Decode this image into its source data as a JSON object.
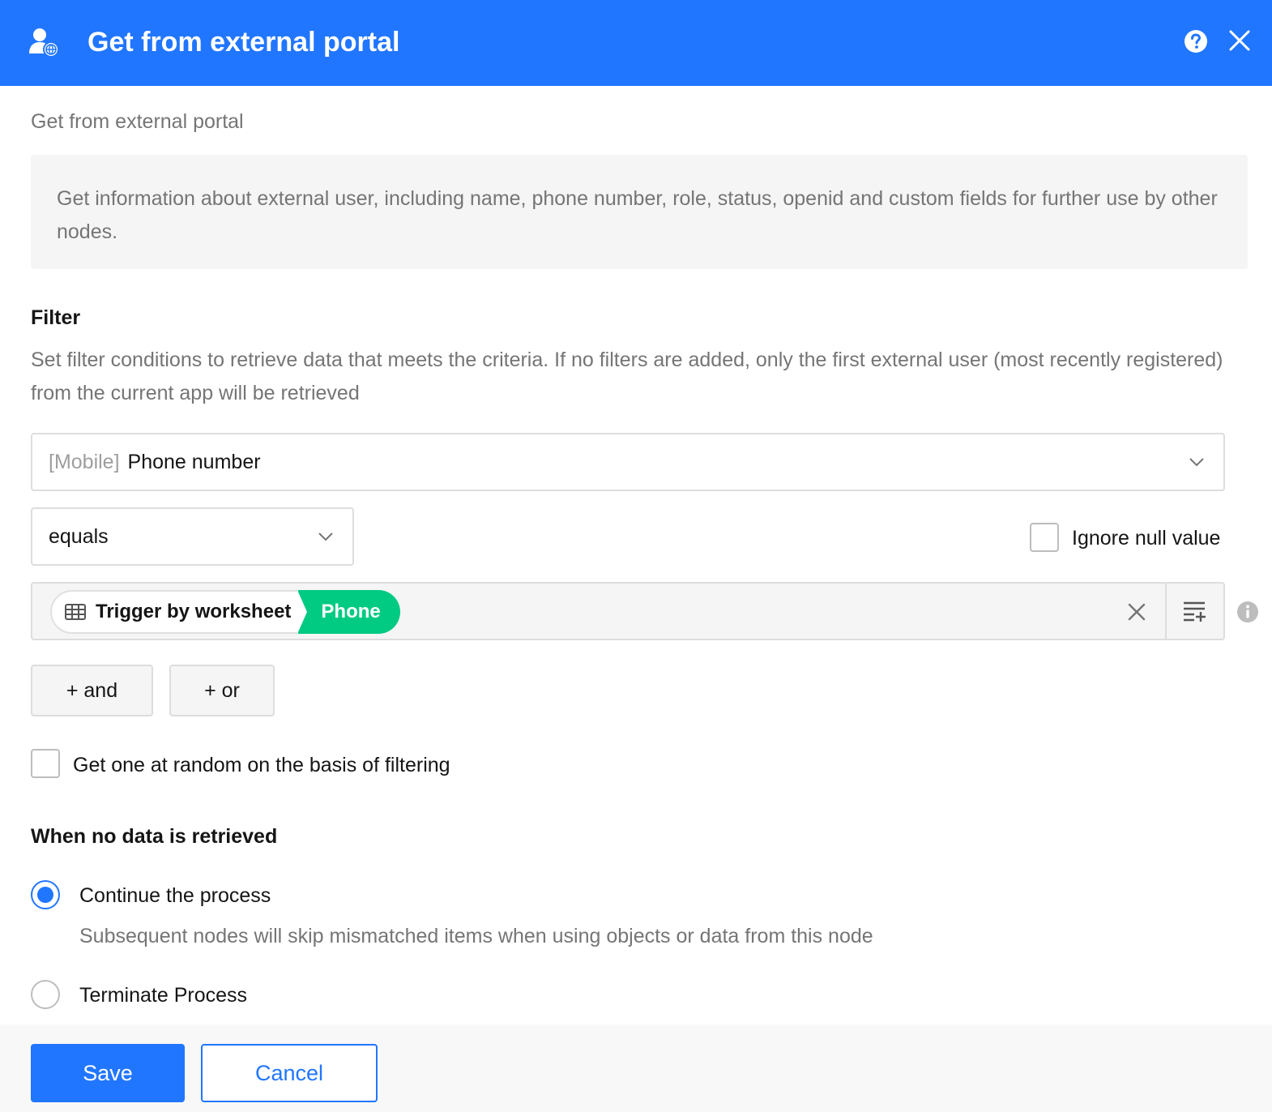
{
  "header": {
    "title": "Get from external portal",
    "icon": "external-user-icon",
    "help_icon": "help-circle-icon",
    "close_icon": "close-icon",
    "background": "#2176ff"
  },
  "node_name": "Get from external portal",
  "description": "Get information about external user, including name, phone number, role, status, openid and custom fields for further use by other nodes.",
  "filter": {
    "title": "Filter",
    "description": "Set filter conditions to retrieve data that meets the criteria. If no filters are added, only the first external user (most recently registered) from the current app will be retrieved",
    "field": {
      "prefix": "[Mobile]",
      "label": "Phone number"
    },
    "operator": "equals",
    "ignore_null_label": "Ignore null value",
    "value": {
      "source_label": "Trigger by worksheet",
      "field_label": "Phone"
    },
    "add_and_label": "+ and",
    "add_or_label": "+ or"
  },
  "random_label": "Get one at random on the basis of filtering",
  "no_data": {
    "title": "When no data is retrieved",
    "options": [
      {
        "label": "Continue the process",
        "sub": "Subsequent nodes will skip mismatched items when using objects or data from this node",
        "selected": true
      },
      {
        "label": "Terminate Process",
        "selected": false
      }
    ]
  },
  "footer": {
    "save_label": "Save",
    "cancel_label": "Cancel"
  },
  "colors": {
    "accent": "#2176ff",
    "chip_green": "#01ca83"
  }
}
